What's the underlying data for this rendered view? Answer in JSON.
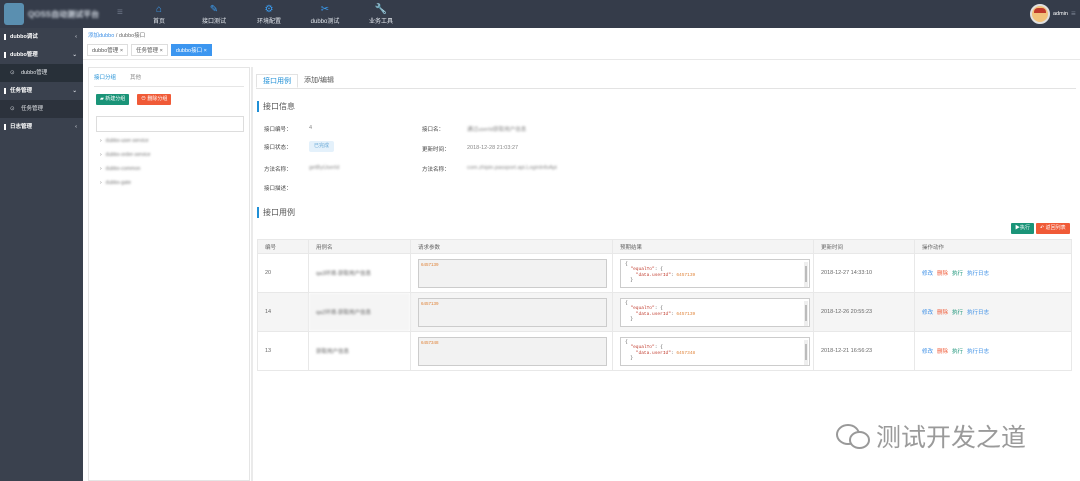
{
  "header": {
    "app_title": "QOSS自动测试平台",
    "user": "admin",
    "nav": [
      {
        "label": "首页",
        "icon": "home-icon"
      },
      {
        "label": "接口测试",
        "icon": "edit-icon"
      },
      {
        "label": "环境配置",
        "icon": "gear-icon"
      },
      {
        "label": "dubbo测试",
        "icon": "tools-icon"
      },
      {
        "label": "业务工具",
        "icon": "wrench-icon"
      }
    ]
  },
  "sidebar": {
    "items": [
      {
        "label": "dubbo调试",
        "arrow": "‹"
      },
      {
        "label": "dubbo管理",
        "arrow": "⌄"
      },
      {
        "label": "dubbo管理",
        "sub": true
      },
      {
        "label": "任务管理",
        "arrow": "⌄"
      },
      {
        "label": "任务管理",
        "sub": true
      },
      {
        "label": "日志管理",
        "arrow": "‹"
      }
    ]
  },
  "breadcrumb": {
    "link": "添加dubbo",
    "sep": "/",
    "current": "dubbo接口"
  },
  "tabs": [
    {
      "label": "dubbo管理",
      "close": "×"
    },
    {
      "label": "任务管理",
      "close": "×"
    },
    {
      "label": "dubbo接口",
      "close": "×",
      "active": true
    }
  ],
  "left_panel": {
    "tab_group": "接口分组",
    "tab_other": "其他",
    "new_group": "新建分组",
    "del_group": "删除分组",
    "tree": [
      "dubbo-user-service",
      "dubbo-order-service",
      "dubbo-common",
      "dubbo-gate"
    ]
  },
  "detail": {
    "tab_cases": "接口用例",
    "tab_edit": "添加/编辑",
    "info_title": "接口信息",
    "id_label": "接口编号：",
    "id_value": "4",
    "name_label": "接口名：",
    "name_value": "通过userId获取用户信息",
    "status_label": "接口状态：",
    "status_value": "已完成",
    "updated_label": "更新时间：",
    "updated_value": "2018-12-28 21:03:27",
    "method_label": "方法名称：",
    "method_value": "getByUserId",
    "class_label": "方法名称：",
    "class_value": "com.zhipin.passport.api.LoginInfoApi",
    "desc_label": "接口描述：",
    "cases_title": "接口用例",
    "btn_exec": "执行",
    "btn_back": "返回列表"
  },
  "table": {
    "headers": [
      "编号",
      "用例名",
      "请求参数",
      "预期结果",
      "更新时间",
      "操作动作"
    ],
    "rows": [
      {
        "id": "20",
        "name": "qa3环境-获取用户信息",
        "param": "6457139",
        "expect_val": "6457139",
        "time": "2018-12-27 14:33:10"
      },
      {
        "id": "14",
        "name": "qa2环境-获取用户信息",
        "param": "6457139",
        "expect_val": "6457139",
        "time": "2018-12-26 20:55:23"
      },
      {
        "id": "13",
        "name": "获取用户信息",
        "param": "6457348",
        "expect_val": "6457348",
        "time": "2018-12-21 16:56:23"
      }
    ],
    "actions": {
      "edit": "修改",
      "del": "删除",
      "run": "执行",
      "log": "执行日志"
    }
  },
  "watermark": "测试开发之道"
}
